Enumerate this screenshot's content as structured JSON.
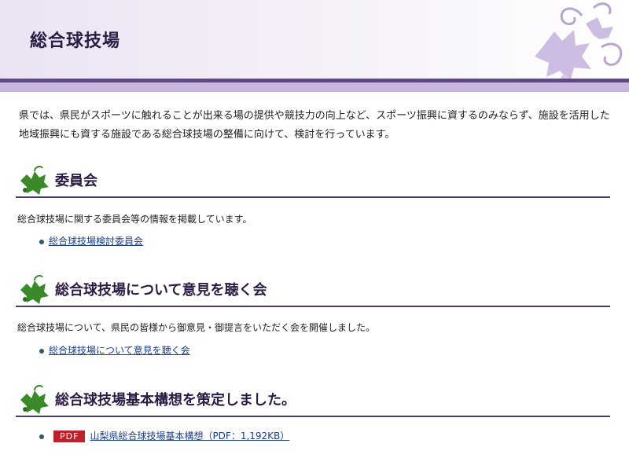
{
  "header": {
    "title": "総合球技場"
  },
  "intro": "県では、県民がスポーツに触れることが出来る場の提供や競技力の向上など、スポーツ振興に資するのみならず、施設を活用した地域振興にも資する施設である総合球技場の整備に向けて、検討を行っています。",
  "sections": [
    {
      "title": "委員会",
      "desc": "総合球技場に関する委員会等の情報を掲載しています。",
      "link": "総合球技場検討委員会"
    },
    {
      "title": "総合球技場について意見を聴く会",
      "desc": "総合球技場について、県民の皆様から御意見・御提言をいただく会を開催しました。",
      "link": "総合球技場について意見を聴く会"
    },
    {
      "title": "総合球技場基本構想を策定しました。",
      "pdf_label": "PDF",
      "link": "山梨県総合球技場基本構想（PDF：1,192KB）"
    }
  ],
  "colors": {
    "accent": "#5d4a80",
    "title": "#2a1c44",
    "link": "#1a3e8a",
    "pdf": "#c0212a",
    "grape": "#3a8a2a"
  }
}
